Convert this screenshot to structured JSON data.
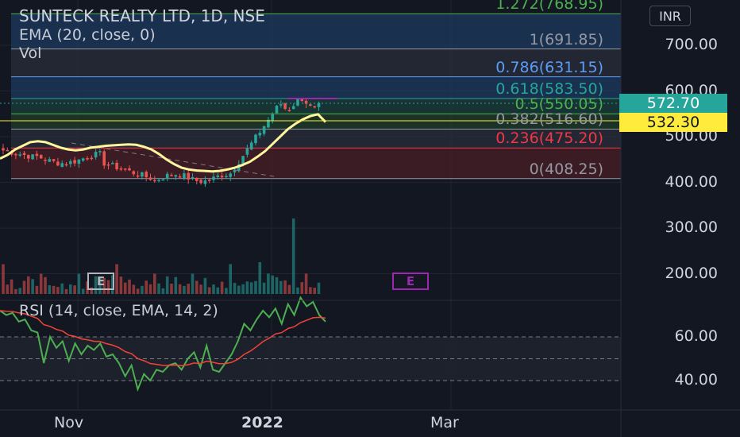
{
  "chart_title": "SUNTECK REALTY LTD, 1D, NSE",
  "legend": {
    "ema": "EMA (20, close, 0)",
    "volume": "Vol",
    "rsi": "RSI (14, close, EMA, 14, 2)"
  },
  "currency_button": "INR",
  "price_axis": [
    "700.00",
    "600.00",
    "500.00",
    "400.00",
    "300.00",
    "200.00"
  ],
  "rsi_axis": [
    "60.00",
    "40.00"
  ],
  "time_axis": [
    "Nov",
    "2022",
    "Mar"
  ],
  "last_price": {
    "label": "572.70",
    "color": "#26a69a"
  },
  "ema_price": {
    "label": "532.30",
    "color": "#ffeb3b"
  },
  "earnings_badges": [
    {
      "label": "E",
      "color": "#b2b5be"
    },
    {
      "label": "E",
      "color": "#9c27b0"
    }
  ],
  "fib_levels": [
    {
      "label": "1.272(768.95)",
      "color": "#4caf50"
    },
    {
      "label": "1(691.85)",
      "color": "#9598a1"
    },
    {
      "label": "0.786(631.15)",
      "color": "#5b9cf6"
    },
    {
      "label": "0.618(583.50)",
      "color": "#26a69a"
    },
    {
      "label": "0.5(550.05)",
      "color": "#4caf50"
    },
    {
      "label": "0.382(516.60)",
      "color": "#9598a1"
    },
    {
      "label": "0.236(475.20)",
      "color": "#f23645"
    },
    {
      "label": "0(408.25)",
      "color": "#9598a1"
    }
  ],
  "colors": {
    "up": "#26a69a",
    "down": "#ef5350",
    "ema": "#fff59d",
    "rsi": "#4caf50",
    "rsi_signal": "#f44336",
    "background": "#131722"
  },
  "chart_data": {
    "type": "candlestick",
    "symbol": "SUNTECK REALTY LTD",
    "interval": "1D",
    "exchange": "NSE",
    "price_range": [
      150,
      790
    ],
    "rsi_range": [
      30,
      80
    ],
    "series": [
      {
        "name": "EMA (20, close, 0)",
        "values": [
          452,
          460,
          472,
          480,
          488,
          490,
          488,
          482,
          476,
          472,
          470,
          472,
          476,
          478,
          480,
          481,
          482,
          483,
          482,
          478,
          472,
          462,
          450,
          440,
          432,
          428,
          426,
          425,
          424,
          425,
          428,
          432,
          438,
          445,
          456,
          468,
          484,
          500,
          516,
          528,
          538,
          545,
          549,
          532
        ]
      },
      {
        "name": "RSI (14, close, EMA, 14, 2)",
        "values": [
          72,
          70,
          71,
          67,
          68,
          63,
          62,
          48,
          60,
          55,
          58,
          49,
          57,
          52,
          56,
          54,
          57,
          51,
          52,
          48,
          42,
          47,
          36,
          43,
          40,
          45,
          44,
          47,
          48,
          45,
          50,
          53,
          46,
          56,
          45,
          44,
          48,
          52,
          58,
          66,
          63,
          68,
          72,
          69,
          73,
          66,
          75,
          70,
          78,
          74,
          76,
          70,
          67
        ]
      }
    ]
  }
}
